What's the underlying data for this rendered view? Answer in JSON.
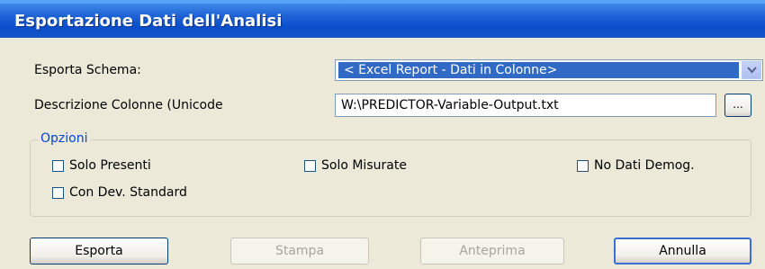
{
  "title": "Esportazione Dati dell'Analisi",
  "fields": {
    "schema_label": "Esporta Schema:",
    "schema_value": "< Excel Report - Dati  in Colonne>",
    "descr_label": "Descrizione Colonne (Unicode",
    "descr_value": "W:\\PREDICTOR-Variable-Output.txt",
    "browse_label": "..."
  },
  "options": {
    "legend": "Opzioni",
    "items": [
      {
        "label": "Solo Presenti",
        "checked": false
      },
      {
        "label": "Solo Misurate",
        "checked": false
      },
      {
        "label": "No Dati Demog.",
        "checked": false
      },
      {
        "label": "Con Dev. Standard",
        "checked": false
      }
    ]
  },
  "buttons": {
    "export": "Esporta",
    "print": "Stampa",
    "preview": "Anteprima",
    "cancel": "Annulla"
  },
  "colors": {
    "title_bar": "#0a4ecb",
    "selection": "#316ac5",
    "group_legend": "#0046d5"
  }
}
